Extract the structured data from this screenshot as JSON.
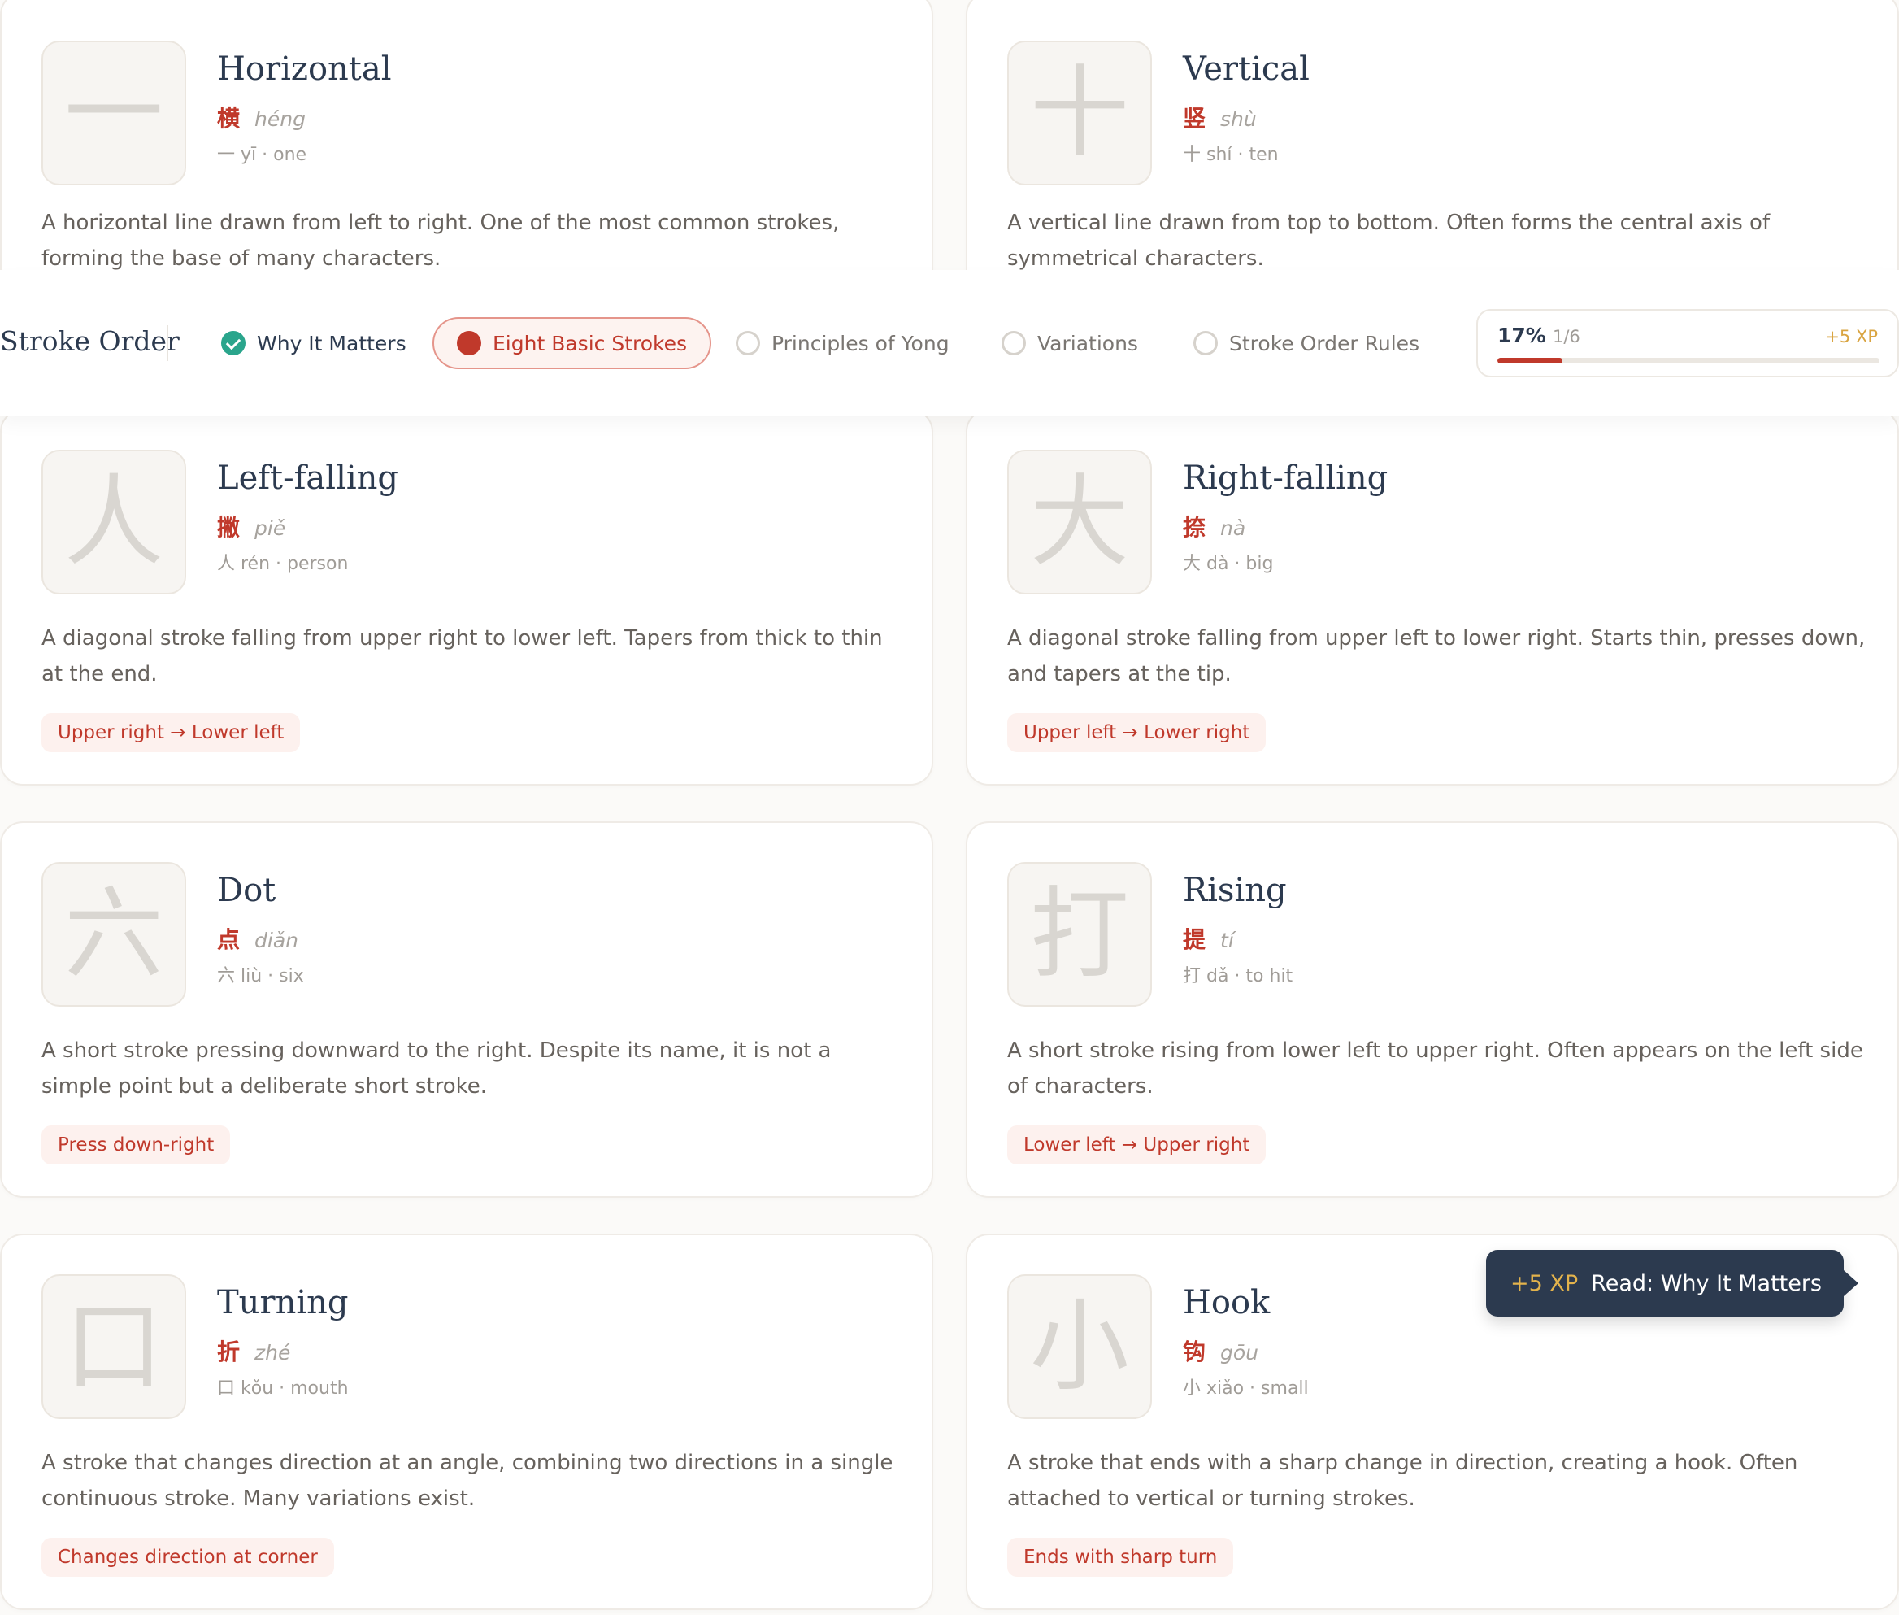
{
  "nav": {
    "title": "Stroke Order",
    "items": [
      {
        "label": "Why It Matters",
        "state": "done"
      },
      {
        "label": "Eight Basic Strokes",
        "state": "active"
      },
      {
        "label": "Principles of Yong",
        "state": "todo"
      },
      {
        "label": "Variations",
        "state": "todo"
      },
      {
        "label": "Stroke Order Rules",
        "state": "todo"
      }
    ],
    "progress": {
      "percent_label": "17%",
      "count": "1/6",
      "xp": "+5 XP",
      "fraction": 0.17
    }
  },
  "strokes": [
    {
      "glyph": "一",
      "name": "Horizontal",
      "cn": "横",
      "pinyin": "héng",
      "example": "一 yī · one",
      "desc": "A horizontal line drawn from left to right. One of the most common strokes, forming the base of many characters.",
      "tag": ""
    },
    {
      "glyph": "十",
      "name": "Vertical",
      "cn": "竖",
      "pinyin": "shù",
      "example": "十 shí · ten",
      "desc": "A vertical line drawn from top to bottom. Often forms the central axis of symmetrical characters.",
      "tag": ""
    },
    {
      "glyph": "人",
      "name": "Left-falling",
      "cn": "撇",
      "pinyin": "piě",
      "example": "人 rén · person",
      "desc": "A diagonal stroke falling from upper right to lower left. Tapers from thick to thin at the end.",
      "tag": "Upper right → Lower left"
    },
    {
      "glyph": "大",
      "name": "Right-falling",
      "cn": "捺",
      "pinyin": "nà",
      "example": "大 dà · big",
      "desc": "A diagonal stroke falling from upper left to lower right. Starts thin, presses down, and tapers at the tip.",
      "tag": "Upper left → Lower right"
    },
    {
      "glyph": "六",
      "name": "Dot",
      "cn": "点",
      "pinyin": "diǎn",
      "example": "六 liù · six",
      "desc": "A short stroke pressing downward to the right. Despite its name, it is not a simple point but a deliberate short stroke.",
      "tag": "Press down-right"
    },
    {
      "glyph": "打",
      "name": "Rising",
      "cn": "提",
      "pinyin": "tí",
      "example": "打 dǎ · to hit",
      "desc": "A short stroke rising from lower left to upper right. Often appears on the left side of characters.",
      "tag": "Lower left → Upper right"
    },
    {
      "glyph": "口",
      "name": "Turning",
      "cn": "折",
      "pinyin": "zhé",
      "example": "口 kǒu · mouth",
      "desc": "A stroke that changes direction at an angle, combining two directions in a single continuous stroke. Many variations exist.",
      "tag": "Changes direction at corner"
    },
    {
      "glyph": "小",
      "name": "Hook",
      "cn": "钩",
      "pinyin": "gōu",
      "example": "小 xiǎo · small",
      "desc": "A stroke that ends with a sharp change in direction, creating a hook. Often attached to vertical or turning strokes.",
      "tag": "Ends with sharp turn"
    }
  ],
  "toast": {
    "xp": "+5 XP",
    "text": "Read: Why It Matters"
  }
}
